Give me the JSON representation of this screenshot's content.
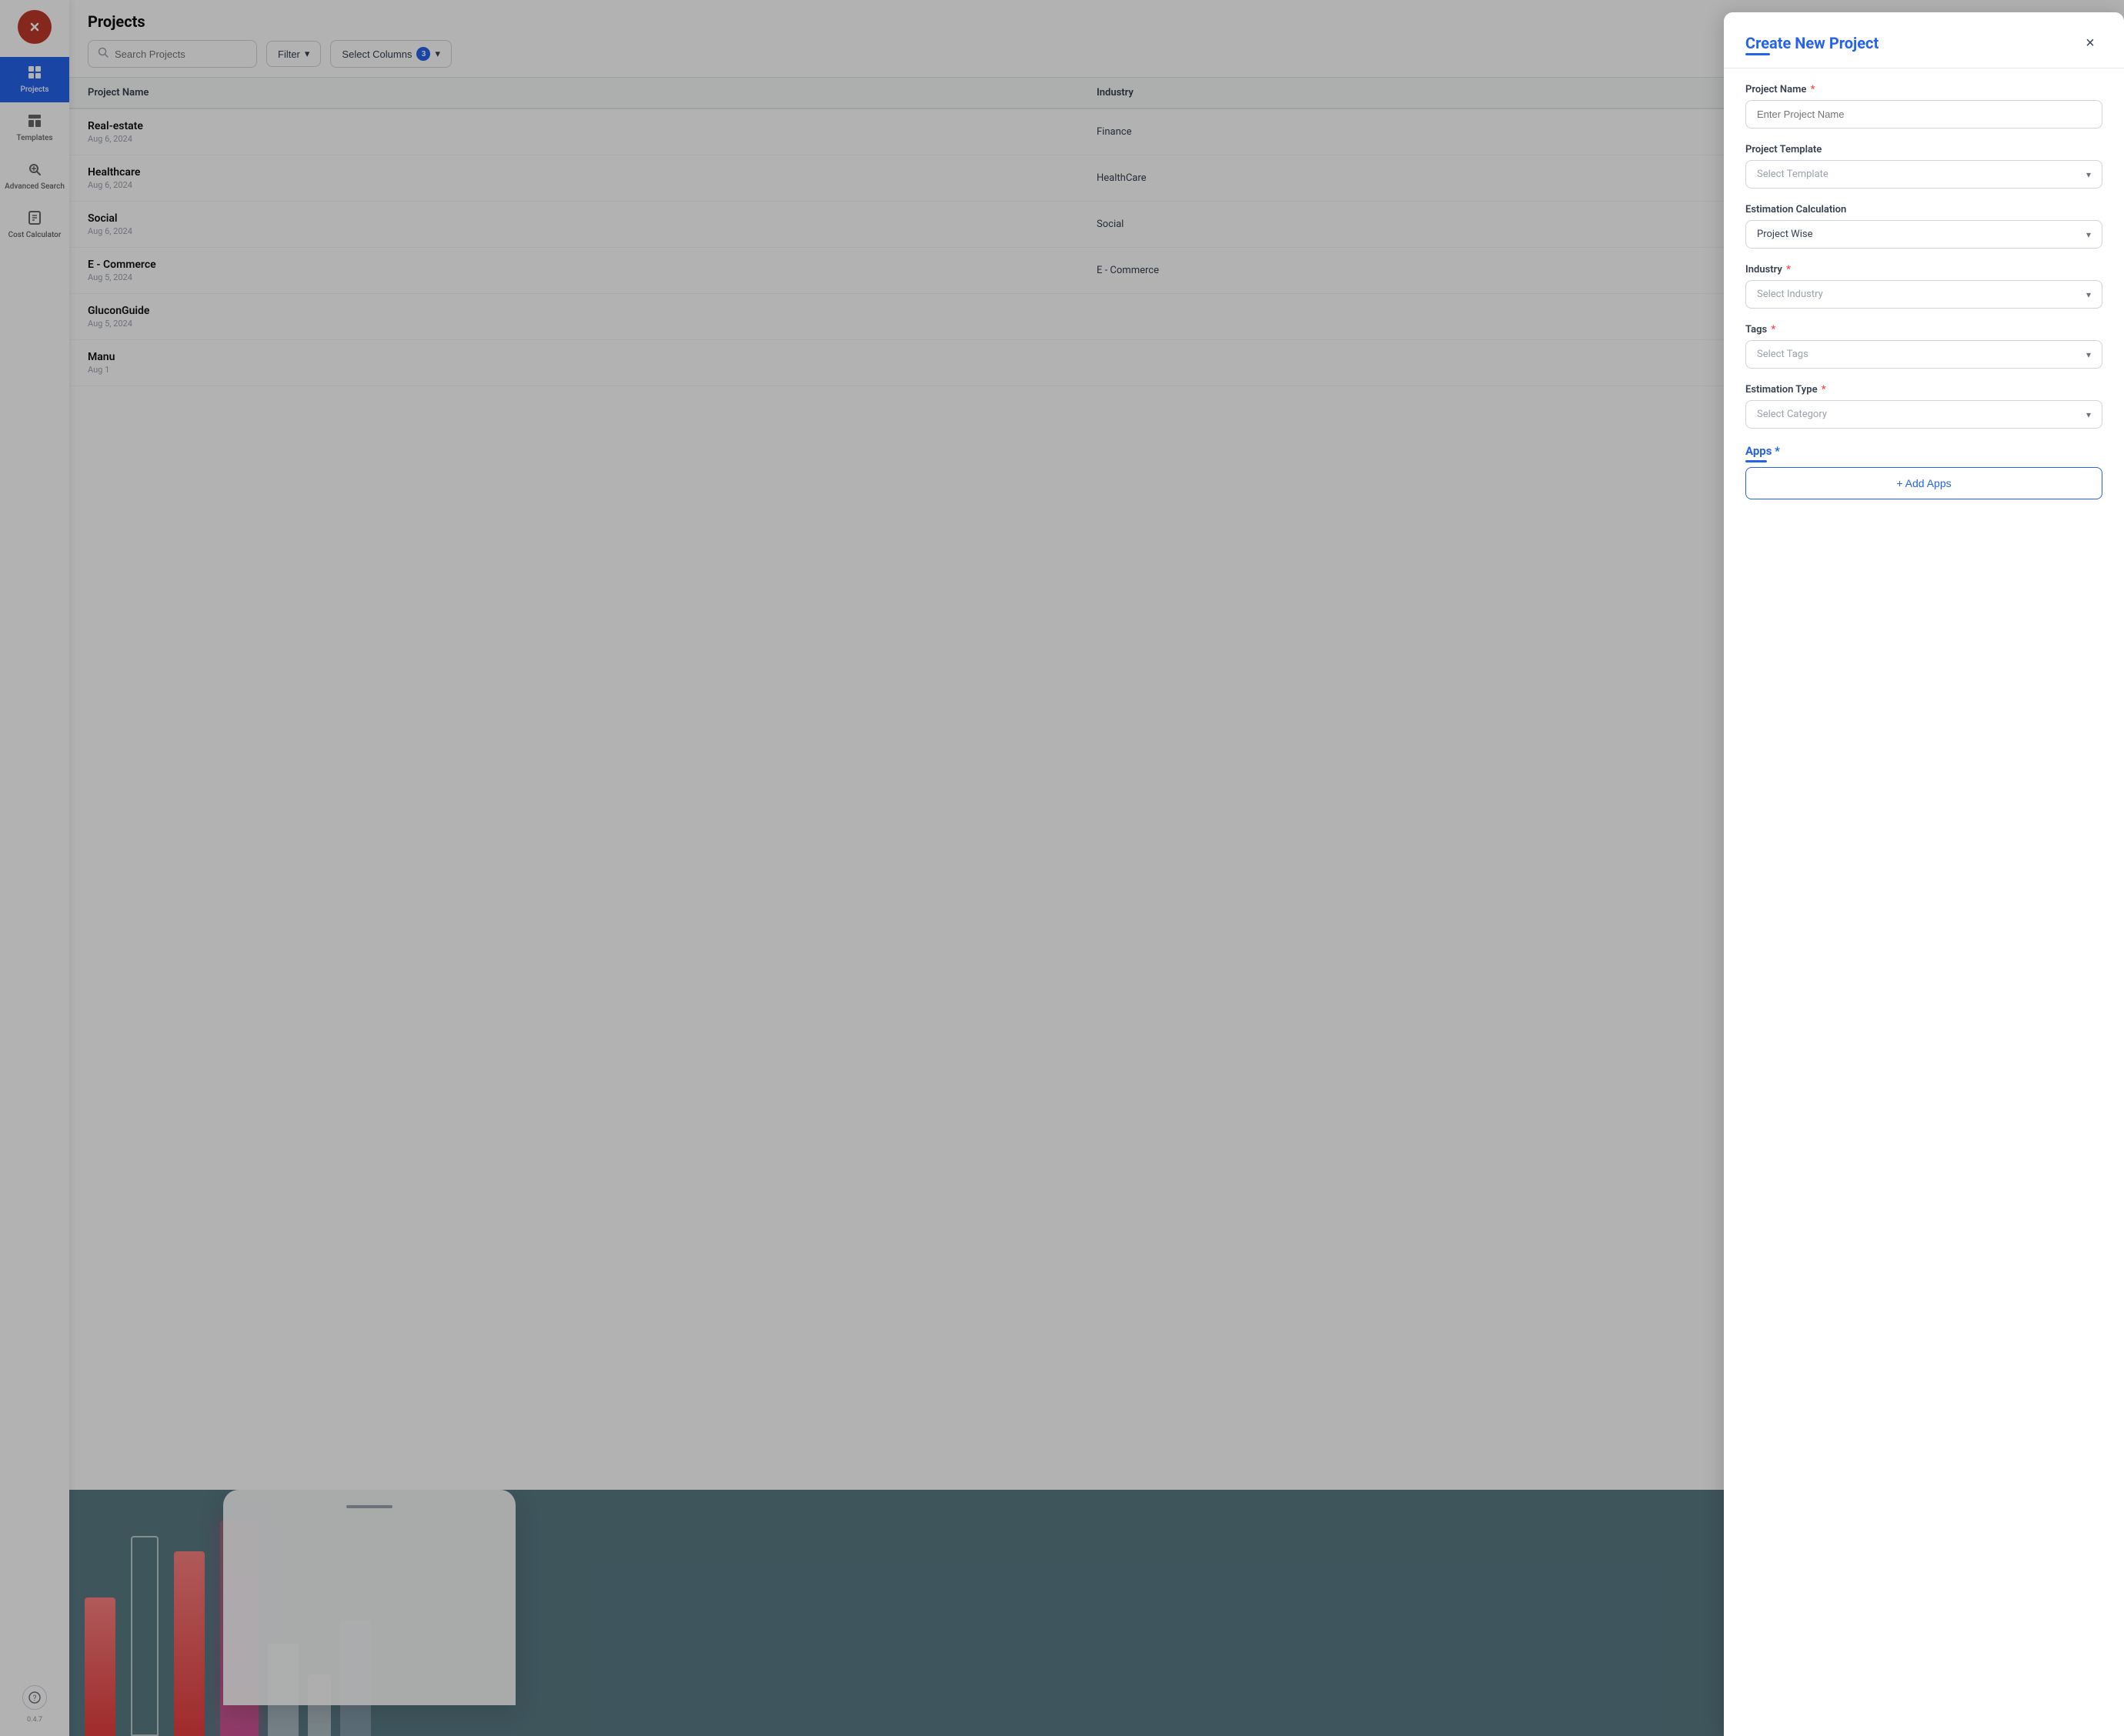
{
  "sidebar": {
    "logo_text": "X",
    "items": [
      {
        "id": "projects",
        "label": "Projects",
        "icon": "⊞",
        "active": true
      },
      {
        "id": "templates",
        "label": "Templates",
        "icon": "⊟",
        "active": false
      },
      {
        "id": "advanced-search",
        "label": "Advanced Search",
        "icon": "⊠",
        "active": false
      },
      {
        "id": "cost-calculator",
        "label": "Cost Calculator",
        "icon": "⊡",
        "active": false
      }
    ],
    "bottom_icon": "◎",
    "version": "0.4.7"
  },
  "projects_page": {
    "title": "Projects",
    "search_placeholder": "Search Projects",
    "filter_label": "Filter",
    "columns_label": "Select Columns",
    "columns_count": "3",
    "table": {
      "headers": [
        "Project Name",
        "Industry"
      ],
      "rows": [
        {
          "name": "Real-estate",
          "date": "Aug 6, 2024",
          "industry": "Finance"
        },
        {
          "name": "Healthcare",
          "date": "Aug 6, 2024",
          "industry": "HealthCare"
        },
        {
          "name": "Social",
          "date": "Aug 6, 2024",
          "industry": "Social"
        },
        {
          "name": "E - Commerce",
          "date": "Aug 5, 2024",
          "industry": "E - Commerce"
        },
        {
          "name": "GluconGuide",
          "date": "Aug 5, 2024",
          "industry": ""
        },
        {
          "name": "Manu",
          "date": "Aug 1",
          "industry": ""
        }
      ]
    }
  },
  "modal": {
    "title": "Create New Project",
    "close_label": "×",
    "fields": {
      "project_name": {
        "label": "Project Name",
        "required": true,
        "placeholder": "Enter Project Name"
      },
      "project_template": {
        "label": "Project Template",
        "required": false,
        "placeholder": "Select Template"
      },
      "estimation_calculation": {
        "label": "Estimation Calculation",
        "required": false,
        "value": "Project Wise",
        "placeholder": "Project Wise"
      },
      "industry": {
        "label": "Industry",
        "required": true,
        "placeholder": "Select Industry"
      },
      "tags": {
        "label": "Tags",
        "required": true,
        "placeholder": "Select Tags"
      },
      "estimation_type": {
        "label": "Estimation Type",
        "required": true,
        "placeholder": "Select Category"
      },
      "apps": {
        "label": "Apps",
        "required": true,
        "add_label": "+ Add Apps"
      }
    }
  }
}
